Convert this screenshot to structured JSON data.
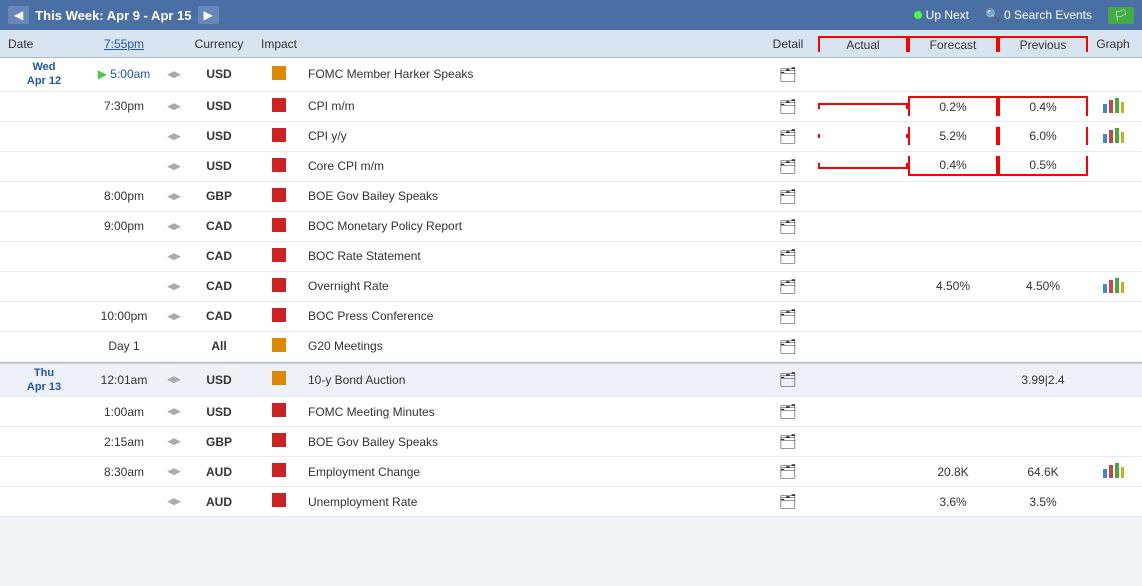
{
  "topBar": {
    "weekLabel": "This Week: Apr 9 - Apr 15",
    "prevArrow": "◀",
    "nextArrow": "▶",
    "upNext": "Up Next",
    "searchEvents": "0 Search Events",
    "flagLabel": "🏳"
  },
  "columns": {
    "date": "Date",
    "time": "7:55pm",
    "spacer": "",
    "currency": "Currency",
    "impact": "Impact",
    "event": "",
    "detail": "Detail",
    "actual": "Actual",
    "forecast": "Forecast",
    "previous": "Previous",
    "graph": "Graph"
  },
  "rows": [
    {
      "date": "Wed\nApr 12",
      "time": "5:00am",
      "timeHighlight": true,
      "hasSpeaker": true,
      "currency": "USD",
      "impactColor": "orange",
      "event": "FOMC Member Harker Speaks",
      "actual": "",
      "forecast": "",
      "previous": "",
      "hasGraph": false
    },
    {
      "date": "",
      "time": "7:30pm",
      "timeHighlight": false,
      "hasSpeaker": true,
      "currency": "USD",
      "impactColor": "red",
      "event": "CPI m/m",
      "actual": "",
      "forecast": "0.2%",
      "previous": "0.4%",
      "hasGraph": true,
      "highlightActual": true,
      "highlightForecast": true,
      "highlightPrevious": true,
      "acTop": true,
      "fcTop": true,
      "prTop": true
    },
    {
      "date": "",
      "time": "",
      "timeHighlight": false,
      "hasSpeaker": true,
      "currency": "USD",
      "impactColor": "red",
      "event": "CPI y/y",
      "actual": "",
      "forecast": "5.2%",
      "previous": "6.0%",
      "hasGraph": true,
      "highlightActual": true,
      "highlightForecast": true,
      "highlightPrevious": true
    },
    {
      "date": "",
      "time": "",
      "timeHighlight": false,
      "hasSpeaker": true,
      "currency": "USD",
      "impactColor": "red",
      "event": "Core CPI m/m",
      "actual": "",
      "forecast": "0.4%",
      "previous": "0.5%",
      "hasGraph": false,
      "highlightActual": true,
      "highlightForecast": true,
      "highlightPrevious": true,
      "acBottom": true,
      "fcBottom": true,
      "prBottom": true
    },
    {
      "date": "",
      "time": "8:00pm",
      "timeHighlight": false,
      "hasSpeaker": true,
      "currency": "GBP",
      "impactColor": "red",
      "event": "BOE Gov Bailey Speaks",
      "actual": "",
      "forecast": "",
      "previous": "",
      "hasGraph": false
    },
    {
      "date": "",
      "time": "9:00pm",
      "timeHighlight": false,
      "hasSpeaker": true,
      "currency": "CAD",
      "impactColor": "red",
      "event": "BOC Monetary Policy Report",
      "actual": "",
      "forecast": "",
      "previous": "",
      "hasGraph": false
    },
    {
      "date": "",
      "time": "",
      "timeHighlight": false,
      "hasSpeaker": true,
      "currency": "CAD",
      "impactColor": "red",
      "event": "BOC Rate Statement",
      "actual": "",
      "forecast": "",
      "previous": "",
      "hasGraph": false
    },
    {
      "date": "",
      "time": "",
      "timeHighlight": false,
      "hasSpeaker": true,
      "currency": "CAD",
      "impactColor": "red",
      "event": "Overnight Rate",
      "actual": "",
      "forecast": "4.50%",
      "previous": "4.50%",
      "hasGraph": true
    },
    {
      "date": "",
      "time": "10:00pm",
      "timeHighlight": false,
      "hasSpeaker": true,
      "currency": "CAD",
      "impactColor": "red",
      "event": "BOC Press Conference",
      "actual": "",
      "forecast": "",
      "previous": "",
      "hasGraph": false
    },
    {
      "date": "",
      "time": "Day 1",
      "timeHighlight": false,
      "hasSpeaker": false,
      "currency": "All",
      "impactColor": "orange",
      "event": "G20 Meetings",
      "actual": "",
      "forecast": "",
      "previous": "",
      "hasGraph": false,
      "isAllDay": true
    },
    {
      "date": "Thu\nApr 13",
      "time": "12:01am",
      "timeHighlight": false,
      "hasSpeaker": true,
      "currency": "USD",
      "impactColor": "orange",
      "event": "10-y Bond Auction",
      "actual": "",
      "forecast": "",
      "previous": "3.99|2.4",
      "hasGraph": false
    },
    {
      "date": "",
      "time": "1:00am",
      "timeHighlight": false,
      "hasSpeaker": true,
      "currency": "USD",
      "impactColor": "red",
      "event": "FOMC Meeting Minutes",
      "actual": "",
      "forecast": "",
      "previous": "",
      "hasGraph": false
    },
    {
      "date": "",
      "time": "2:15am",
      "timeHighlight": false,
      "hasSpeaker": true,
      "currency": "GBP",
      "impactColor": "red",
      "event": "BOE Gov Bailey Speaks",
      "actual": "",
      "forecast": "",
      "previous": "",
      "hasGraph": false
    },
    {
      "date": "",
      "time": "8:30am",
      "timeHighlight": false,
      "hasSpeaker": true,
      "currency": "AUD",
      "impactColor": "red",
      "event": "Employment Change",
      "actual": "",
      "forecast": "20.8K",
      "previous": "64.6K",
      "hasGraph": true
    },
    {
      "date": "",
      "time": "",
      "timeHighlight": false,
      "hasSpeaker": true,
      "currency": "AUD",
      "impactColor": "red",
      "event": "Unemployment Rate",
      "actual": "",
      "forecast": "3.6%",
      "previous": "3.5%",
      "hasGraph": false
    }
  ]
}
